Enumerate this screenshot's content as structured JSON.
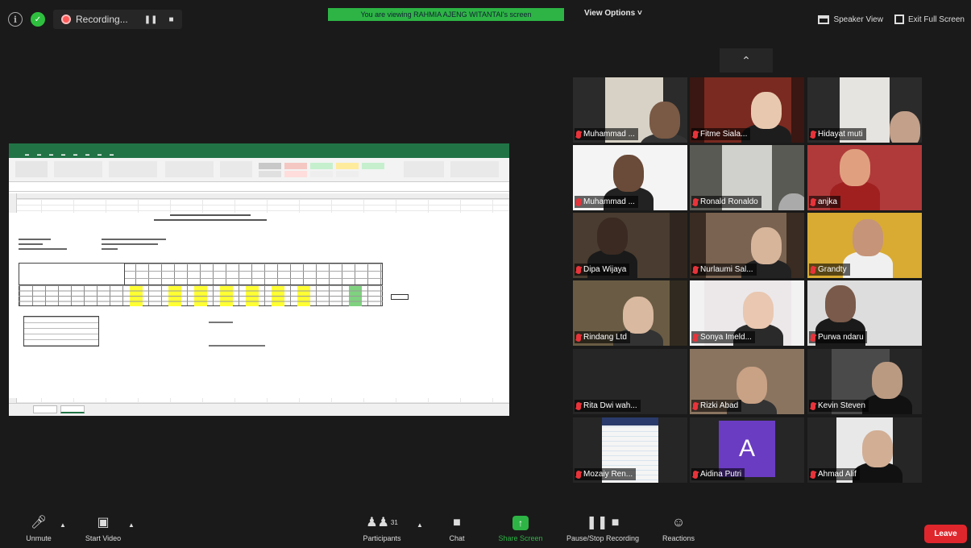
{
  "topbar": {
    "recording_label": "Recording...",
    "pause_label": "❚❚",
    "stop_label": "■",
    "viewing_banner": "You are viewing RAHMIA AJENG WITANTAI's screen",
    "view_options_label": "View Options ˅",
    "speaker_view_label": "Speaker View",
    "exit_full_screen_label": "Exit Full Screen"
  },
  "shared_screen": {
    "app": "Microsoft Excel",
    "sheet_title": "DAFTAR NILAI SISWA",
    "sheet_subtitle": "SEKOLAH TINGGI ILMU EKONOMI"
  },
  "gallery": {
    "collapse_label": "⌃",
    "participants": [
      {
        "name": "Muhammad ...",
        "muted": true
      },
      {
        "name": "Fitme Siala...",
        "muted": true
      },
      {
        "name": "Hidayat muti",
        "muted": true
      },
      {
        "name": "Muhammad ...",
        "muted": true
      },
      {
        "name": "Ronald Ronaldo",
        "muted": true
      },
      {
        "name": "anjka",
        "muted": true
      },
      {
        "name": "Dipa Wijaya",
        "muted": true
      },
      {
        "name": "Nurlaumi Sal...",
        "muted": true
      },
      {
        "name": "Grandty",
        "muted": true
      },
      {
        "name": "Rindang Ltd",
        "muted": true
      },
      {
        "name": "Sonya Imeld...",
        "muted": true
      },
      {
        "name": "Purwa ndaru",
        "muted": true
      },
      {
        "name": "Rita Dwi wah...",
        "muted": true
      },
      {
        "name": "Rizki Abad",
        "muted": true
      },
      {
        "name": "Kevin Steven",
        "muted": true
      },
      {
        "name": "Mozaiy Ren...",
        "muted": true
      },
      {
        "name": "Aidina Putri",
        "muted": true,
        "avatar_letter": "A",
        "avatar_color": "#6a3cc2"
      },
      {
        "name": "Ahmad Alif",
        "muted": true
      }
    ]
  },
  "toolbar": {
    "unmute_label": "Unmute",
    "start_video_label": "Start Video",
    "participants_label": "Participants",
    "participants_count": "31",
    "chat_label": "Chat",
    "share_screen_label": "Share Screen",
    "pause_stop_recording_label": "Pause/Stop Recording",
    "reactions_label": "Reactions",
    "leave_label": "Leave"
  },
  "colors": {
    "accent_green": "#2db445",
    "leave_red": "#e0262d",
    "mute_red": "#e8333a",
    "excel_green": "#217346"
  }
}
